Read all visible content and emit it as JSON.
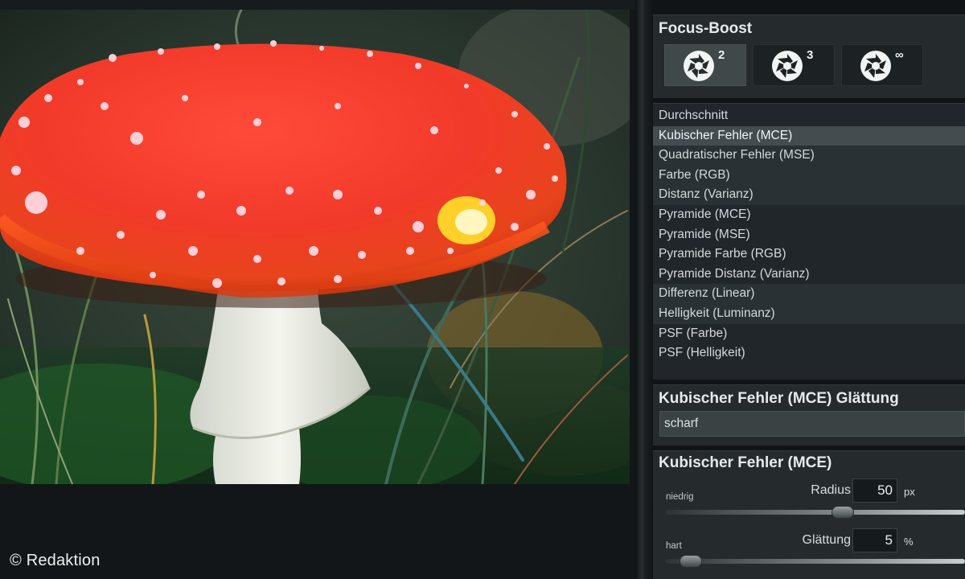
{
  "viewer": {
    "copyright": "© Redaktion"
  },
  "focus_boost": {
    "title": "Focus-Boost",
    "buttons": [
      {
        "icon": "aperture-icon",
        "label": "2",
        "active": true
      },
      {
        "icon": "aperture-icon",
        "label": "3",
        "active": false
      },
      {
        "icon": "aperture-icon",
        "label": "∞",
        "active": false
      }
    ]
  },
  "methods": {
    "items": [
      "Durchschnitt",
      "Kubischer Fehler (MCE)",
      "Quadratischer Fehler (MSE)",
      "Farbe (RGB)",
      "Distanz (Varianz)",
      "Pyramide (MCE)",
      "Pyramide (MSE)",
      "Pyramide Farbe (RGB)",
      "Pyramide Distanz (Varianz)",
      "Differenz (Linear)",
      "Helligkeit (Luminanz)",
      "PSF (Farbe)",
      "PSF (Helligkeit)"
    ],
    "selected": "Kubischer Fehler (MCE)"
  },
  "smoothing": {
    "title": "Kubischer Fehler (MCE) Glättung",
    "value": "scharf"
  },
  "mce": {
    "title": "Kubischer Fehler (MCE)",
    "radius": {
      "min_label": "niedrig",
      "label": "Radius",
      "value": "50",
      "unit": "px",
      "level": 0.6
    },
    "smoothing": {
      "min_label": "hart",
      "label": "Glättung",
      "value": "5",
      "unit": "%",
      "level": 0.05
    }
  },
  "colors": {
    "panel": "#252b2d",
    "selected_row": "#444c4f",
    "mushroom_cap": "#f23a2a"
  }
}
